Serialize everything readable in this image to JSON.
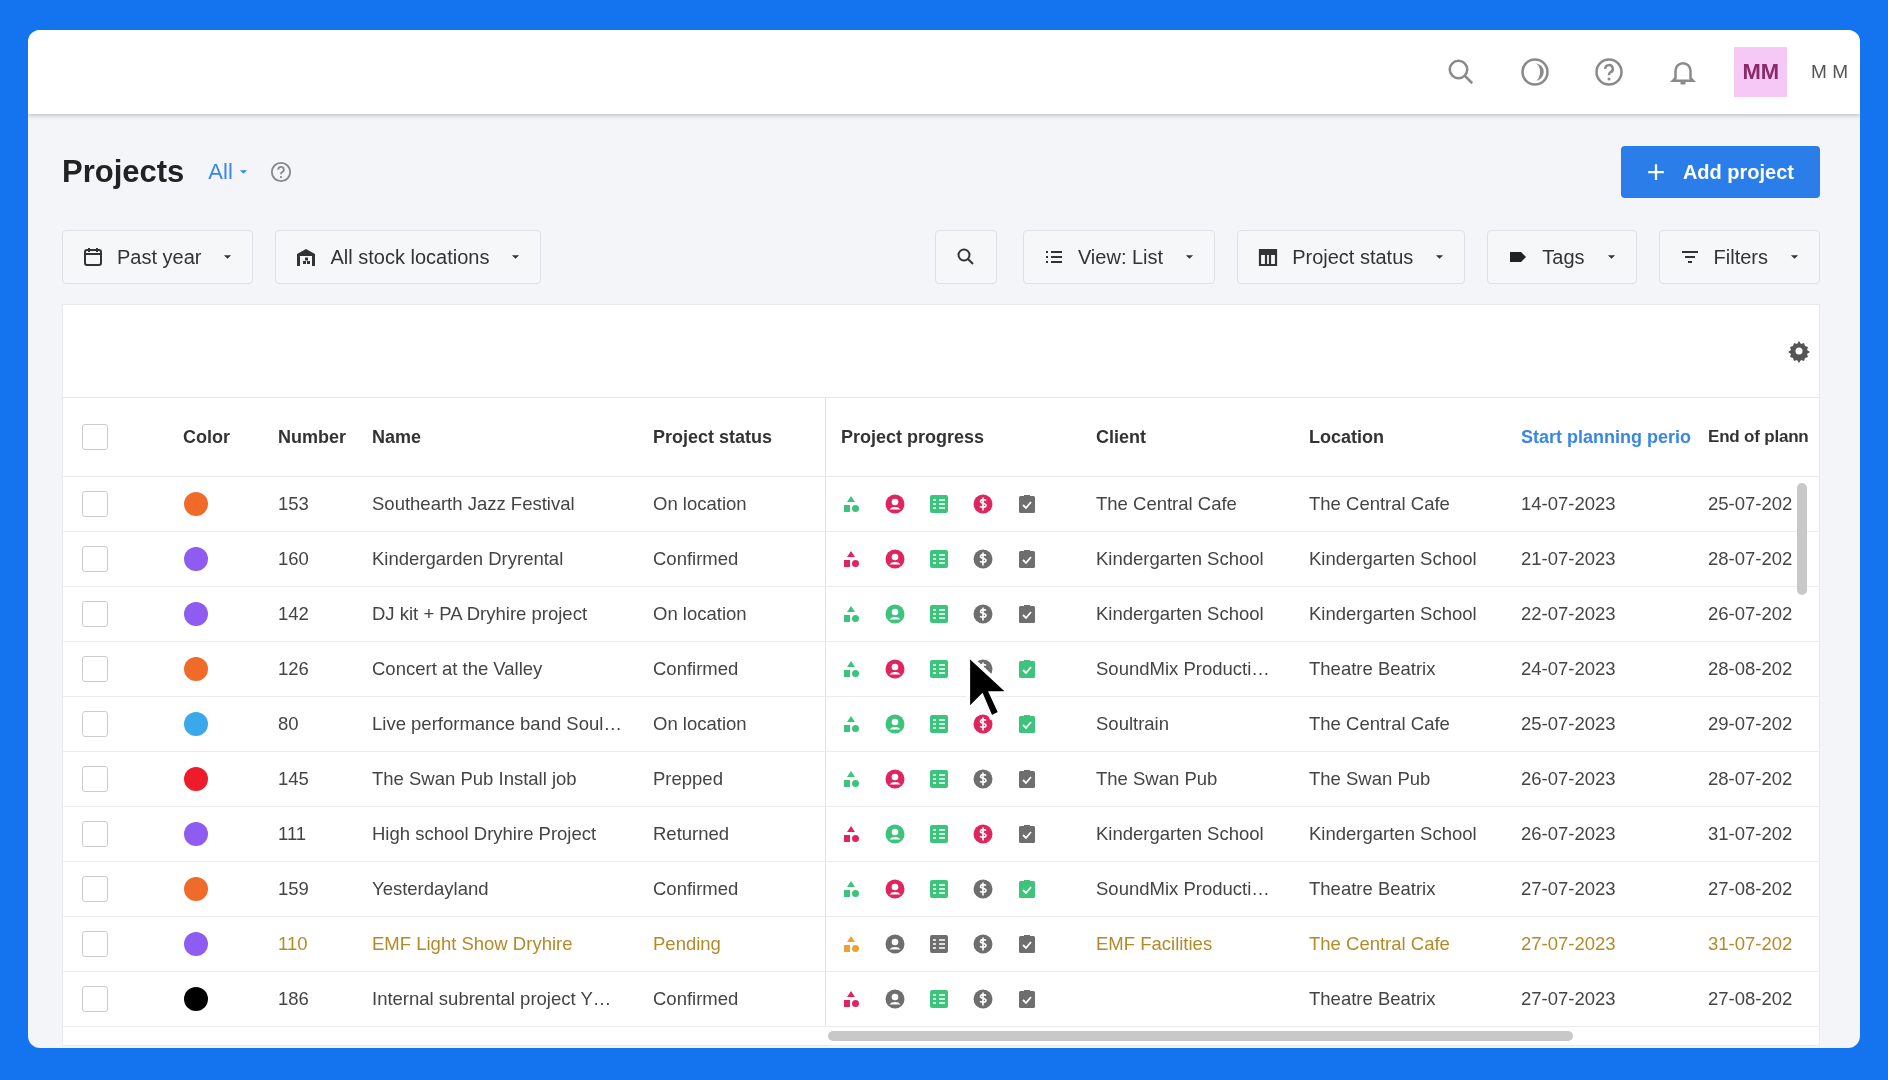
{
  "topbar": {
    "avatar": "MM",
    "user": "M M"
  },
  "header": {
    "title": "Projects",
    "scope": "All"
  },
  "add_button": "Add project",
  "filters": {
    "period": "Past year",
    "locations": "All stock locations",
    "view": "View: List",
    "status": "Project status",
    "tags": "Tags",
    "filters": "Filters"
  },
  "table": {
    "select_all_checked": false,
    "columns": [
      {
        "label": "Color",
        "sorted": false
      },
      {
        "label": "Number",
        "sorted": false
      },
      {
        "label": "Name",
        "sorted": false
      },
      {
        "label": "Project status",
        "sorted": false
      },
      {
        "label": "Project progress",
        "sorted": false
      },
      {
        "label": "Client",
        "sorted": false
      },
      {
        "label": "Location",
        "sorted": false
      },
      {
        "label": "Start planning perio",
        "sorted": true
      },
      {
        "label": "End of plann",
        "sorted": false
      }
    ],
    "rows": [
      {
        "color": "#f06a2a",
        "number": "153",
        "name": "Southearth Jazz Festival",
        "status": "On location",
        "client": "The Central Cafe",
        "location": "The Central Cafe",
        "start": "14-07-2023",
        "end": "25-07-202",
        "pending": false,
        "progress": [
          {
            "kind": "equipment",
            "color": "#3cc47c"
          },
          {
            "kind": "crew",
            "color": "#e0245e"
          },
          {
            "kind": "list",
            "color": "#3cc47c"
          },
          {
            "kind": "money",
            "color": "#e0245e"
          },
          {
            "kind": "check",
            "color": "#6e6e6e"
          }
        ]
      },
      {
        "color": "#8e5cf0",
        "number": "160",
        "name": "Kindergarden Dryrental",
        "status": "Confirmed",
        "client": "Kindergarten School",
        "location": "Kindergarten School",
        "start": "21-07-2023",
        "end": "28-07-202",
        "pending": false,
        "progress": [
          {
            "kind": "equipment",
            "color": "#e0245e"
          },
          {
            "kind": "crew",
            "color": "#e0245e"
          },
          {
            "kind": "list",
            "color": "#3cc47c"
          },
          {
            "kind": "money",
            "color": "#6e6e6e"
          },
          {
            "kind": "check",
            "color": "#6e6e6e"
          }
        ]
      },
      {
        "color": "#8e5cf0",
        "number": "142",
        "name": "DJ kit + PA Dryhire project",
        "status": "On location",
        "client": "Kindergarten School",
        "location": "Kindergarten School",
        "start": "22-07-2023",
        "end": "26-07-202",
        "pending": false,
        "progress": [
          {
            "kind": "equipment",
            "color": "#3cc47c"
          },
          {
            "kind": "crew",
            "color": "#3cc47c"
          },
          {
            "kind": "list",
            "color": "#3cc47c"
          },
          {
            "kind": "money",
            "color": "#6e6e6e"
          },
          {
            "kind": "check",
            "color": "#6e6e6e"
          }
        ]
      },
      {
        "color": "#f06a2a",
        "number": "126",
        "name": "Concert at the Valley",
        "status": "Confirmed",
        "client": "SoundMix Producti…",
        "location": "Theatre Beatrix",
        "start": "24-07-2023",
        "end": "28-08-202",
        "pending": false,
        "progress": [
          {
            "kind": "equipment",
            "color": "#3cc47c"
          },
          {
            "kind": "crew",
            "color": "#e0245e"
          },
          {
            "kind": "list",
            "color": "#3cc47c"
          },
          {
            "kind": "money",
            "color": "#6e6e6e"
          },
          {
            "kind": "check",
            "color": "#3cc47c"
          }
        ]
      },
      {
        "color": "#3aa8ea",
        "number": "80",
        "name": "Live performance band Soul…",
        "status": "On location",
        "client": "Soultrain",
        "location": "The Central Cafe",
        "start": "25-07-2023",
        "end": "29-07-202",
        "pending": false,
        "progress": [
          {
            "kind": "equipment",
            "color": "#3cc47c"
          },
          {
            "kind": "crew",
            "color": "#3cc47c"
          },
          {
            "kind": "list",
            "color": "#3cc47c"
          },
          {
            "kind": "money",
            "color": "#e0245e"
          },
          {
            "kind": "check",
            "color": "#3cc47c"
          }
        ]
      },
      {
        "color": "#ee1c2a",
        "number": "145",
        "name": "The Swan Pub Install job",
        "status": "Prepped",
        "client": "The Swan Pub",
        "location": "The Swan Pub",
        "start": "26-07-2023",
        "end": "28-07-202",
        "pending": false,
        "progress": [
          {
            "kind": "equipment",
            "color": "#3cc47c"
          },
          {
            "kind": "crew",
            "color": "#e0245e"
          },
          {
            "kind": "list",
            "color": "#3cc47c"
          },
          {
            "kind": "money",
            "color": "#6e6e6e"
          },
          {
            "kind": "check",
            "color": "#6e6e6e"
          }
        ]
      },
      {
        "color": "#8e5cf0",
        "number": "111",
        "name": "High school Dryhire Project",
        "status": "Returned",
        "client": "Kindergarten School",
        "location": "Kindergarten School",
        "start": "26-07-2023",
        "end": "31-07-202",
        "pending": false,
        "progress": [
          {
            "kind": "equipment",
            "color": "#e0245e"
          },
          {
            "kind": "crew",
            "color": "#3cc47c"
          },
          {
            "kind": "list",
            "color": "#3cc47c"
          },
          {
            "kind": "money",
            "color": "#e0245e"
          },
          {
            "kind": "check",
            "color": "#6e6e6e"
          }
        ]
      },
      {
        "color": "#f06a2a",
        "number": "159",
        "name": "Yesterdayland",
        "status": "Confirmed",
        "client": "SoundMix Producti…",
        "location": "Theatre Beatrix",
        "start": "27-07-2023",
        "end": "27-08-202",
        "pending": false,
        "progress": [
          {
            "kind": "equipment",
            "color": "#3cc47c"
          },
          {
            "kind": "crew",
            "color": "#e0245e"
          },
          {
            "kind": "list",
            "color": "#3cc47c"
          },
          {
            "kind": "money",
            "color": "#6e6e6e"
          },
          {
            "kind": "check",
            "color": "#3cc47c"
          }
        ]
      },
      {
        "color": "#8e5cf0",
        "number": "110",
        "name": "EMF Light Show Dryhire",
        "status": "Pending",
        "client": "EMF Facilities",
        "location": "The Central Cafe",
        "start": "27-07-2023",
        "end": "31-07-202",
        "pending": true,
        "progress": [
          {
            "kind": "equipment",
            "color": "#f0a030"
          },
          {
            "kind": "crew",
            "color": "#6e6e6e"
          },
          {
            "kind": "list",
            "color": "#6e6e6e"
          },
          {
            "kind": "money",
            "color": "#6e6e6e"
          },
          {
            "kind": "check",
            "color": "#6e6e6e"
          }
        ]
      },
      {
        "color": "#000000",
        "number": "186",
        "name": "Internal subrental project Y…",
        "status": "Confirmed",
        "location": "Theatre Beatrix",
        "start": "27-07-2023",
        "end": "27-08-202",
        "pending": false,
        "progress": [
          {
            "kind": "equipment",
            "color": "#e0245e"
          },
          {
            "kind": "crew",
            "color": "#6e6e6e"
          },
          {
            "kind": "list",
            "color": "#3cc47c"
          },
          {
            "kind": "money",
            "color": "#6e6e6e"
          },
          {
            "kind": "check",
            "color": "#6e6e6e"
          }
        ]
      }
    ]
  }
}
